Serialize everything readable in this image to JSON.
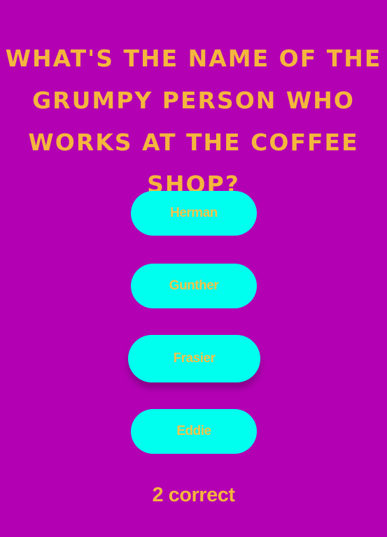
{
  "colors": {
    "background": "#b300b3",
    "accent_text": "#f4b63d",
    "button_background": "#00ffee",
    "button_text": "#f3c34b"
  },
  "question": {
    "text": "What's the name of the grumpy person who works at the coffee shop?"
  },
  "answers": [
    {
      "label": "Herman"
    },
    {
      "label": "Gunther"
    },
    {
      "label": "Frasier",
      "hovered": true
    },
    {
      "label": "Eddie"
    }
  ],
  "score": {
    "text": "2 correct"
  }
}
